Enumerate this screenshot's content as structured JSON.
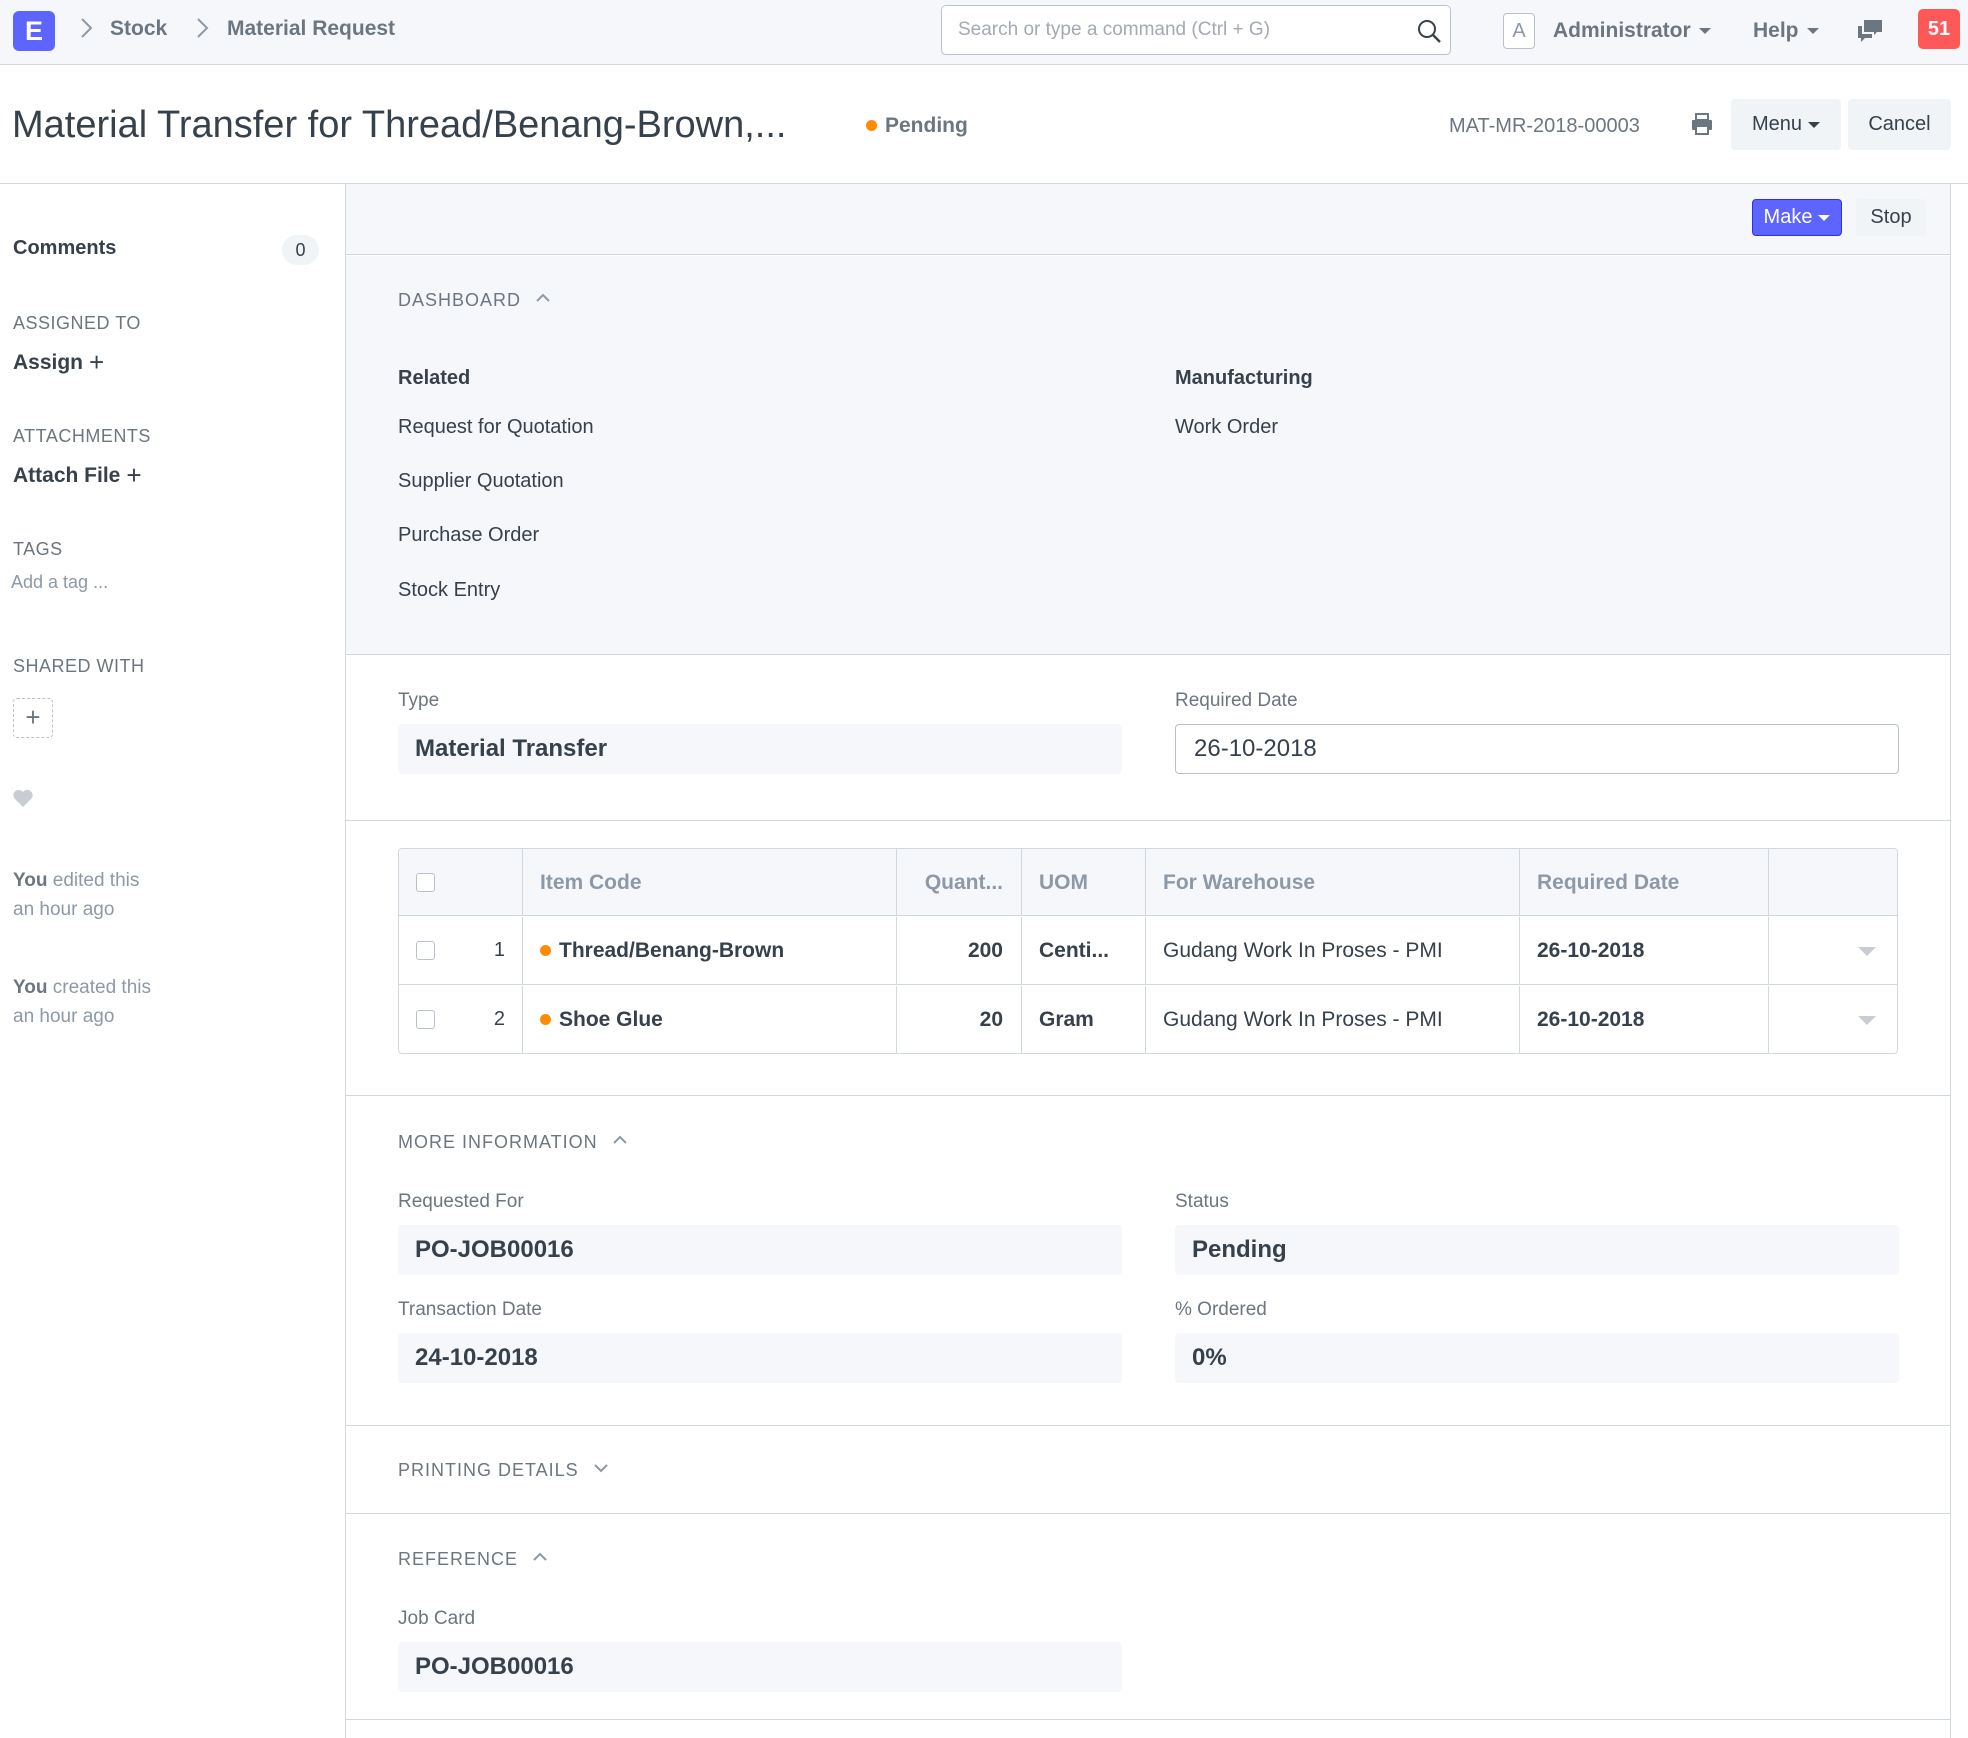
{
  "navbar": {
    "app_logo": "E",
    "breadcrumbs": [
      "Stock",
      "Material Request"
    ],
    "search_placeholder": "Search or type a command (Ctrl + G)",
    "avatar_letter": "A",
    "user": "Administrator",
    "help": "Help",
    "notifications": "51"
  },
  "page": {
    "title": "Material Transfer for Thread/Benang-Brown,...",
    "status": "Pending",
    "status_color": "#ff8c00",
    "doc_name": "MAT-MR-2018-00003",
    "menu_label": "Menu",
    "cancel_label": "Cancel"
  },
  "sidebar": {
    "comments_label": "Comments",
    "comments_count": "0",
    "assigned_to_label": "ASSIGNED TO",
    "assign_label": "Assign",
    "attachments_label": "ATTACHMENTS",
    "attach_label": "Attach File",
    "tags_label": "TAGS",
    "tag_placeholder": "Add a tag ...",
    "shared_with_label": "SHARED WITH",
    "activity": [
      {
        "who": "You",
        "what": "edited this",
        "when": "an hour ago"
      },
      {
        "who": "You",
        "what": "created this",
        "when": "an hour ago"
      }
    ]
  },
  "toolbar": {
    "make_label": "Make",
    "stop_label": "Stop",
    "primary_color": "#5e64ff"
  },
  "dashboard": {
    "heading": "DASHBOARD",
    "groups": [
      {
        "title": "Related",
        "links": [
          "Request for Quotation",
          "Supplier Quotation",
          "Purchase Order",
          "Stock Entry"
        ]
      },
      {
        "title": "Manufacturing",
        "links": [
          "Work Order"
        ]
      }
    ]
  },
  "form": {
    "type_label": "Type",
    "type_value": "Material Transfer",
    "required_date_label": "Required Date",
    "required_date_value": "26-10-2018"
  },
  "items": {
    "columns": [
      "Item Code",
      "Quant...",
      "UOM",
      "For Warehouse",
      "Required Date"
    ],
    "rows": [
      {
        "idx": "1",
        "item_code": "Thread/Benang-Brown",
        "qty": "200",
        "uom": "Centi...",
        "warehouse": "Gudang Work In Proses - PMI",
        "required_date": "26-10-2018"
      },
      {
        "idx": "2",
        "item_code": "Shoe Glue",
        "qty": "20",
        "uom": "Gram",
        "warehouse": "Gudang Work In Proses - PMI",
        "required_date": "26-10-2018"
      }
    ]
  },
  "more_info": {
    "heading": "MORE INFORMATION",
    "requested_for_label": "Requested For",
    "requested_for_value": "PO-JOB00016",
    "status_label": "Status",
    "status_value": "Pending",
    "transaction_date_label": "Transaction Date",
    "transaction_date_value": "24-10-2018",
    "ordered_label": "% Ordered",
    "ordered_value": "0%"
  },
  "printing": {
    "heading": "PRINTING DETAILS"
  },
  "reference": {
    "heading": "REFERENCE",
    "job_card_label": "Job Card",
    "job_card_value": "PO-JOB00016"
  }
}
